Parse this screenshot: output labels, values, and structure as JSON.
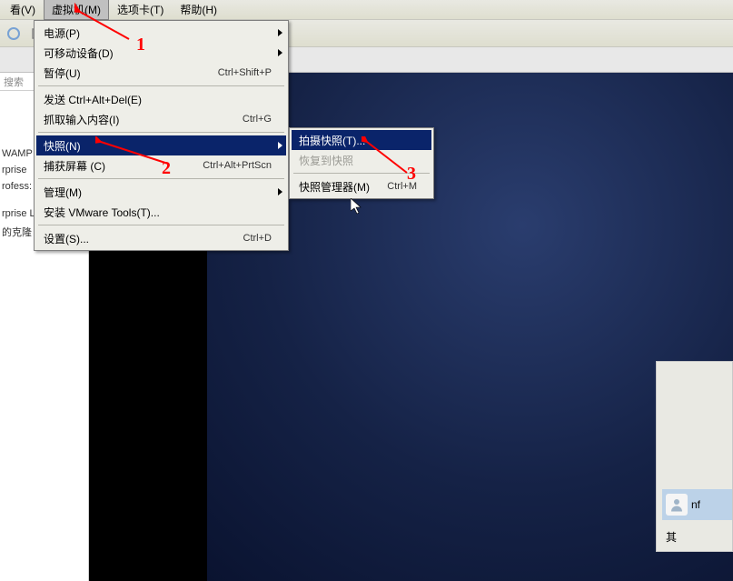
{
  "menubar": {
    "items": [
      {
        "label": "看(V)"
      },
      {
        "label": "虚拟机(M)"
      },
      {
        "label": "选项卡(T)"
      },
      {
        "label": "帮助(H)"
      }
    ]
  },
  "sidebar": {
    "search_placeholder": "搜索",
    "items": [
      "WAMP",
      "rprise",
      "rofess:",
      "rprise Linux",
      "的克隆"
    ]
  },
  "menu": {
    "power": {
      "label": "电源(P)"
    },
    "removable": {
      "label": "可移动设备(D)"
    },
    "pause": {
      "label": "暂停(U)",
      "shortcut": "Ctrl+Shift+P"
    },
    "sendcad": {
      "label": "发送 Ctrl+Alt+Del(E)"
    },
    "grabinput": {
      "label": "抓取输入内容(I)",
      "shortcut": "Ctrl+G"
    },
    "snapshot": {
      "label": "快照(N)"
    },
    "capture": {
      "label": "捕获屏幕 (C)",
      "shortcut": "Ctrl+Alt+PrtScn"
    },
    "manage": {
      "label": "管理(M)"
    },
    "installtools": {
      "label": "安装 VMware Tools(T)..."
    },
    "settings": {
      "label": "设置(S)...",
      "shortcut": "Ctrl+D"
    }
  },
  "submenu": {
    "take": {
      "label": "拍摄快照(T)..."
    },
    "revert": {
      "label": "恢复到快照"
    },
    "mgr": {
      "label": "快照管理器(M)",
      "shortcut": "Ctrl+M"
    }
  },
  "login": {
    "username": "nf",
    "other": "其"
  },
  "annotations": {
    "one": "1",
    "two": "2",
    "three": "3"
  }
}
